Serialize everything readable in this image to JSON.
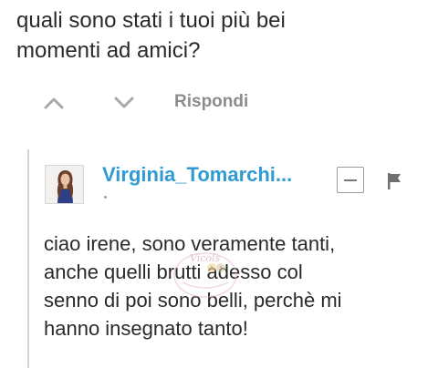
{
  "comment": {
    "text": "quali sono stati i tuoi più bei\nmomenti ad amici?"
  },
  "actions": {
    "upvote_icon": "chevron-up-icon",
    "downvote_icon": "chevron-down-icon",
    "reply_label": "Rispondi"
  },
  "reply": {
    "username": "Virginia_Tomarchi...",
    "text": "ciao irene, sono veramente tanti,\nanche quelli brutti adesso col\nsenno di poi sono belli, perchè mi\nhanno insegnato tanto!",
    "collapse_icon": "minus-box-icon",
    "flag_icon": "flag-icon",
    "watermark_text": "Vicols"
  },
  "colors": {
    "username": "#2f9bd2",
    "reply_label": "#8c8c8c",
    "icon_gray": "#a8a8a8",
    "rule": "#d4d4d4"
  }
}
